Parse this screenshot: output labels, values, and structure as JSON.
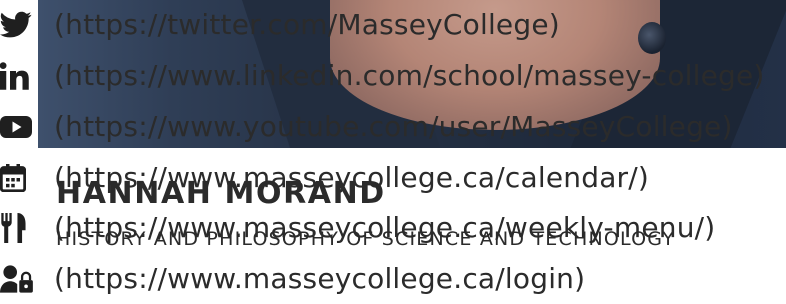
{
  "profile": {
    "name": "HANNAH MORAND",
    "department": "HISTORY AND PHILOSOPHY OF SCIENCE AND TECHNOLOGY"
  },
  "links": [
    {
      "icon": "twitter-icon",
      "text": "(https://twitter.com/MasseyCollege)"
    },
    {
      "icon": "linkedin-icon",
      "text": "(https://www.linkedin.com/school/massey-college)"
    },
    {
      "icon": "youtube-icon",
      "text": "(https://www.youtube.com/user/MasseyCollege)"
    },
    {
      "icon": "calendar-icon",
      "text": "(https://www.masseycollege.ca/calendar/)"
    },
    {
      "icon": "utensils-icon",
      "text": "(https://www.masseycollege.ca/weekly-menu/)"
    },
    {
      "icon": "user-lock-icon",
      "text": "(https://www.masseycollege.ca/login)"
    }
  ]
}
